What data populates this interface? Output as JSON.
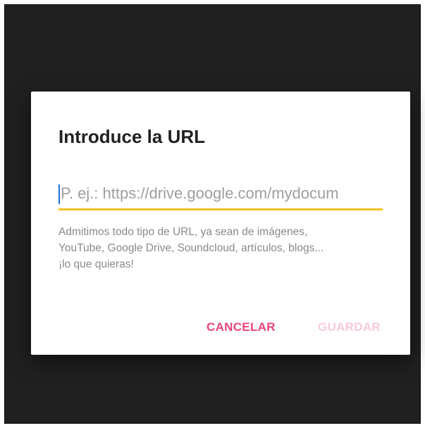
{
  "dialog": {
    "title": "Introduce la URL",
    "url_input": {
      "value": "",
      "placeholder": "P. ej.: https://drive.google.com/mydocum"
    },
    "helper_lines": [
      "Admitimos todo tipo de URL, ya sean de imágenes,",
      "YouTube, Google Drive, Soundcloud, artículos, blogs...",
      "¡lo que quieras!"
    ],
    "buttons": {
      "cancel_label": "CANCELAR",
      "save_label": "GUARDAR"
    }
  },
  "colors": {
    "backdrop": "#202020",
    "accent_underline": "#f6c12a",
    "cursor": "#1e6fd6",
    "button_primary": "#e8437f",
    "button_disabled": "#f7c9da"
  }
}
